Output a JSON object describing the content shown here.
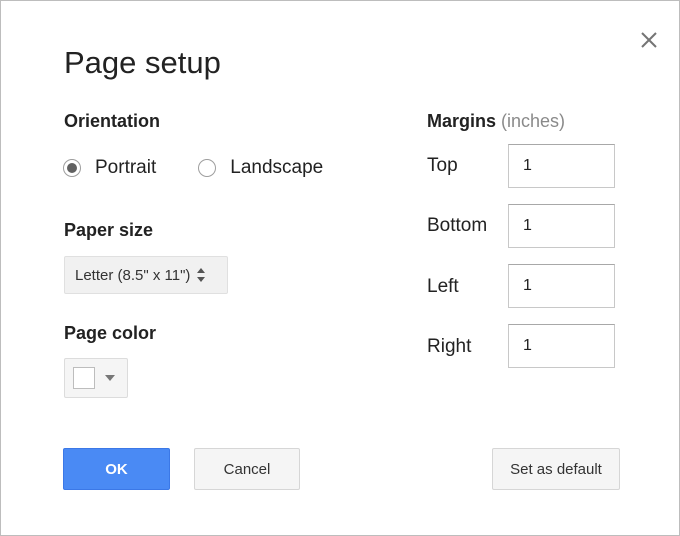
{
  "dialog": {
    "title": "Page setup",
    "close_icon": "close-icon"
  },
  "orientation": {
    "label": "Orientation",
    "options": [
      {
        "label": "Portrait",
        "selected": true
      },
      {
        "label": "Landscape",
        "selected": false
      }
    ]
  },
  "paper_size": {
    "label": "Paper size",
    "value": "Letter (8.5\" x 11\")",
    "icon": "updown-arrows-icon"
  },
  "page_color": {
    "label": "Page color",
    "value": "#ffffff",
    "icon": "caret-down-icon"
  },
  "margins": {
    "label": "Margins",
    "unit": "(inches)",
    "fields": [
      {
        "label": "Top",
        "value": "1"
      },
      {
        "label": "Bottom",
        "value": "1"
      },
      {
        "label": "Left",
        "value": "1"
      },
      {
        "label": "Right",
        "value": "1"
      }
    ]
  },
  "buttons": {
    "ok": "OK",
    "cancel": "Cancel",
    "set_default": "Set as default"
  },
  "colors": {
    "primary": "#4a8af4",
    "text": "#222222",
    "muted": "#8a8a8a"
  }
}
